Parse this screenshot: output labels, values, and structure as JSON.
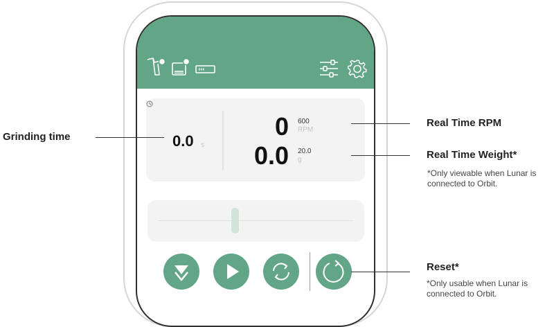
{
  "app": {
    "timer": {
      "value": "0.0",
      "unit": "s"
    },
    "rpm": {
      "value": "0",
      "max": "600",
      "unit": "RPM"
    },
    "weight": {
      "value": "0.0",
      "target": "20.0",
      "unit": "g"
    },
    "slider": {
      "level": 0.39
    },
    "icons": {
      "header_left": [
        "grinder-status-icon",
        "scale-status-icon",
        "battery-icon"
      ],
      "header_right": [
        "sliders-icon",
        "settings-gear-icon"
      ],
      "timer": "clock-icon",
      "controls": [
        "skip-down-icon",
        "play-icon",
        "sync-icon",
        "reset-icon"
      ]
    },
    "colors": {
      "accent": "#62a687",
      "card": "#f3f3f3",
      "slider_thumb": "#cfe5da"
    }
  },
  "annotations": {
    "grinding_time": {
      "title": "Grinding time"
    },
    "rpm": {
      "title": "Real Time RPM"
    },
    "weight": {
      "title": "Real Time Weight*",
      "note": "*Only viewable when Lunar is connected to Orbit."
    },
    "reset": {
      "title": "Reset*",
      "note": "*Only usable when Lunar is connected to Orbit."
    }
  }
}
